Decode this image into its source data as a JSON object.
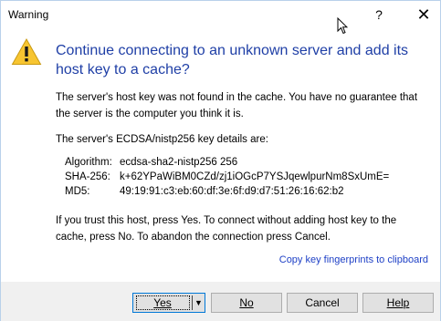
{
  "window": {
    "title": "Warning",
    "help_glyph": "?",
    "close_glyph": "✕"
  },
  "heading": "Continue connecting to an unknown server and add its host key to a cache?",
  "paragraph1": "The server's host key was not found in the cache. You have no guarantee that the server is the computer you think it is.",
  "paragraph2": "The server's ECDSA/nistp256 key details are:",
  "key_details": [
    {
      "key": "Algorithm:",
      "value": "ecdsa-sha2-nistp256 256"
    },
    {
      "key": "SHA-256:",
      "value": "k+62YPaWiBM0CZd/zj1iOGcP7YSJqewlpurNm8SxUmE="
    },
    {
      "key": "MD5:",
      "value": "49:19:91:c3:eb:60:df:3e:6f:d9:d7:51:26:16:62:b2"
    }
  ],
  "paragraph3": "If you trust this host, press Yes. To connect without adding host key to the cache, press No. To abandon the connection press Cancel.",
  "copy_link": "Copy key fingerprints to clipboard",
  "buttons": {
    "yes": "Yes",
    "yes_dropdown": "▼",
    "no": "No",
    "cancel": "Cancel",
    "help": "Help"
  },
  "icons": {
    "warning": "warning-icon",
    "cursor": "mouse-cursor-icon"
  },
  "colors": {
    "heading": "#1f3fa6",
    "link": "#1e40c6",
    "warning_fill": "#f7c531"
  }
}
